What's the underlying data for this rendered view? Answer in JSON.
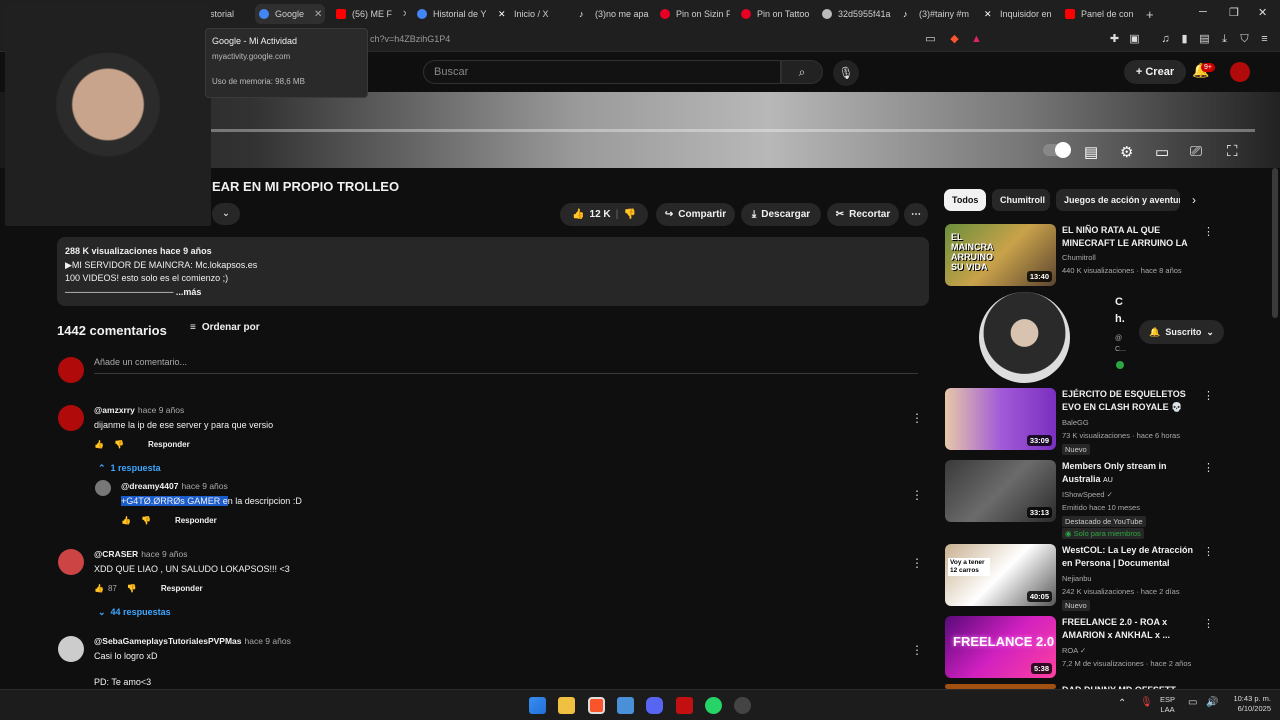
{
  "browser": {
    "tabs": [
      {
        "label": "istorial",
        "color": "#888888"
      },
      {
        "label": "Google",
        "color": "#4285f4"
      },
      {
        "label": "(56) ME F",
        "color": "#ff0000"
      },
      {
        "label": "Historial de Y",
        "color": "#4285f4"
      },
      {
        "label": "Inicio / X",
        "color": "#ffffff"
      },
      {
        "label": "(3)no me apa",
        "color": "#ffffff"
      },
      {
        "label": "Pin on Sizin P",
        "color": "#e60023"
      },
      {
        "label": "Pin on Tattoo",
        "color": "#e60023"
      },
      {
        "label": "32d5955f41a",
        "color": "#bbbbbb"
      },
      {
        "label": "(3)#tainy #m",
        "color": "#ffffff"
      },
      {
        "label": "Inquisidor en",
        "color": "#ffffff"
      },
      {
        "label": "Panel de con",
        "color": "#ff0000"
      }
    ],
    "new_tab": "+",
    "url": "ch?v=h4ZBzihG1P4",
    "tooltip": {
      "title": "Google - Mi Actividad",
      "domain": "myactivity.google.com",
      "memory": "Uso de memoria: 98,6 MB"
    }
  },
  "youtube": {
    "search_placeholder": "Buscar",
    "create_label": "Crear",
    "notif_count": "9+",
    "video_title": "EAR EN MI PROPIO TROLLEO",
    "actions": {
      "likes": "12 K",
      "share": "Compartir",
      "download": "Descargar",
      "clip": "Recortar"
    },
    "description": {
      "meta": "288 K visualizaciones  hace 9 años",
      "line1": "▶MI SERVIDOR DE MAINCRA: Mc.lokapsos.es",
      "line2": "100 VIDEOS! esto solo es el comienzo ;)",
      "line3": "─────────────────",
      "more": "...más"
    },
    "comments": {
      "count": "1442 comentarios",
      "sort": "Ordenar por",
      "add_placeholder": "Añade un comentario...",
      "reply_label": "Responder",
      "items": [
        {
          "author": "@amzxrry",
          "time": "hace 9 años",
          "text": "dijanme la ip de ese server y para que versio",
          "likes": "",
          "replies": "1 respuesta"
        },
        {
          "author": "@dreamy4407",
          "time": "hace 9 años",
          "text_hl": "+G4TØ.ØRRØs GAMER e",
          "text_rest": "n la descripcion :D",
          "likes": ""
        },
        {
          "author": "@CRASER",
          "time": "hace 9 años",
          "text": "XDD QUE LIAO , UN SALUDO LOKAPSOS!!! <3",
          "likes": "87",
          "replies": "44 respuestas"
        },
        {
          "author": "@SebaGameplaysTutorialesPVPMas",
          "time": "hace 9 años",
          "text": "Casi lo logro xD",
          "text2": "PD: Te amo<3"
        }
      ]
    },
    "sidebar": {
      "chips": [
        "Todos",
        "Chumitroll",
        "Juegos de acción y aventura"
      ],
      "subscribed": "Suscrito",
      "channel_card": {
        "l1": "C",
        "l2": "h.",
        "l3": "@",
        "l4": "C..."
      },
      "videos": [
        {
          "title": "EL NIÑO RATA AL QUE MINECRAFT LE ARRUINO LA ...",
          "channel": "Chumitroll",
          "meta": "440 K visualizaciones · hace 8 años",
          "duration": "13:40",
          "thumb_text": "EL MAINCRA ARRUINO SU VIDA"
        },
        {
          "title": "EJÉRCITO DE ESQUELETOS EVO EN CLASH ROYALE 💀",
          "channel": "BaleGG",
          "meta": "73 K visualizaciones · hace 6 horas",
          "badge": "Nuevo",
          "duration": "33:09"
        },
        {
          "title": "Members Only stream in Australia",
          "title_suffix": "AU",
          "channel": "IShowSpeed ✓",
          "meta": "Emitido hace 10 meses",
          "badge": "Destacado de YouTube",
          "badge2": "Solo para miembros",
          "duration": "33:13"
        },
        {
          "title": "WestCOL: La Ley de Atracción en Persona | Documental",
          "channel": "Nejianbu",
          "meta": "242 K visualizaciones · hace 2 días",
          "badge": "Nuevo",
          "duration": "40:05",
          "thumb_text": "Voy a tener 12 carros"
        },
        {
          "title": "FREELANCE 2.0 - ROA x AMARION x ANKHAL x ...",
          "channel": "ROA ✓",
          "meta": "7,2 M de visualizaciones · hace 2 años",
          "duration": "5:38",
          "thumb_text": "FREELANCE 2.0"
        }
      ],
      "last_partial": "DAD DUNNY MD OFFSETT"
    }
  },
  "taskbar": {
    "lang_top": "ESP",
    "lang_bottom": "LAA",
    "time": "10:43 p. m.",
    "date": "6/10/2025"
  }
}
